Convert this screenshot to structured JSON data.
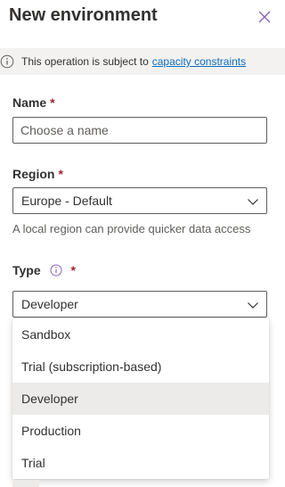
{
  "panel": {
    "title": "New environment",
    "close_icon": "close-icon"
  },
  "info_bar": {
    "text": "This operation is subject to",
    "link": "capacity constraints"
  },
  "name_field": {
    "label": "Name",
    "required_mark": "*",
    "placeholder": "Choose a name",
    "value": ""
  },
  "region_field": {
    "label": "Region",
    "required_mark": "*",
    "value": "Europe - Default",
    "helper": "A local region can provide quicker data access"
  },
  "type_field": {
    "label": "Type",
    "required_mark": "*",
    "value": "Developer",
    "options": [
      "Sandbox",
      "Trial (subscription-based)",
      "Developer",
      "Production",
      "Trial"
    ],
    "selected_option": "Developer"
  },
  "colors": {
    "accent": "#0f6cbd",
    "required": "#a4262c",
    "info_bar_bg": "#f3f2f1",
    "selected_bg": "#edebe9",
    "close_icon": "#8764b8"
  }
}
